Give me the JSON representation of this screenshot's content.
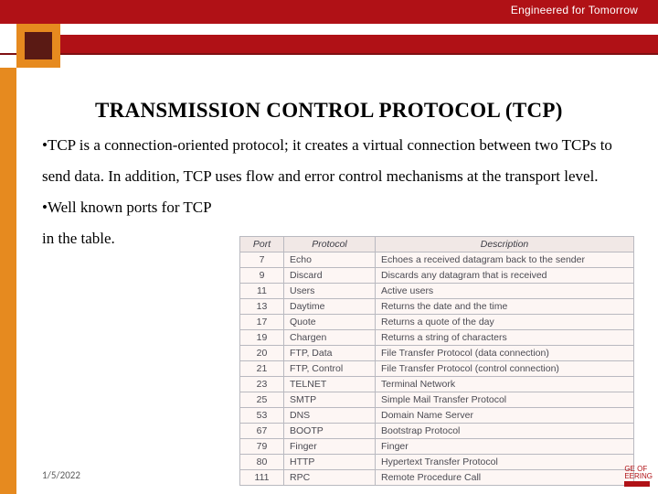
{
  "header": {
    "tagline": "Engineered for Tomorrow"
  },
  "title": "TRANSMISSION CONTROL PROTOCOL (TCP)",
  "body": {
    "p1": "TCP is a connection-oriented protocol; it creates a virtual connection between two TCPs to send data. In addition, TCP uses flow and error control mechanisms at the transport level.",
    "p2a": "Well known ports for TCP",
    "p2b": "in the table."
  },
  "table": {
    "headers": [
      "Port",
      "Protocol",
      "Description"
    ],
    "rows": [
      [
        "7",
        "Echo",
        "Echoes a received datagram back to the sender"
      ],
      [
        "9",
        "Discard",
        "Discards any datagram that is received"
      ],
      [
        "11",
        "Users",
        "Active users"
      ],
      [
        "13",
        "Daytime",
        "Returns the date and the time"
      ],
      [
        "17",
        "Quote",
        "Returns a quote of the day"
      ],
      [
        "19",
        "Chargen",
        "Returns a string of characters"
      ],
      [
        "20",
        "FTP, Data",
        "File Transfer Protocol (data connection)"
      ],
      [
        "21",
        "FTP, Control",
        "File Transfer Protocol (control connection)"
      ],
      [
        "23",
        "TELNET",
        "Terminal Network"
      ],
      [
        "25",
        "SMTP",
        "Simple Mail Transfer Protocol"
      ],
      [
        "53",
        "DNS",
        "Domain Name Server"
      ],
      [
        "67",
        "BOOTP",
        "Bootstrap Protocol"
      ],
      [
        "79",
        "Finger",
        "Finger"
      ],
      [
        "80",
        "HTTP",
        "Hypertext Transfer Protocol"
      ],
      [
        "111",
        "RPC",
        "Remote Procedure Call"
      ]
    ]
  },
  "footer": {
    "date": "1/5/2022",
    "corner1": "GE OF",
    "corner2": "EERING"
  }
}
